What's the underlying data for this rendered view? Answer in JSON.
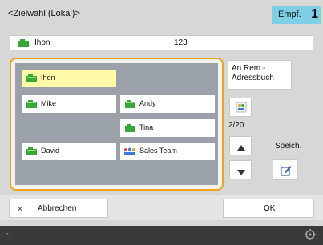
{
  "header": {
    "title": "<Zielwahl (Lokal)>",
    "empf_label": "Empf.",
    "empf_count": "1"
  },
  "selected": {
    "name": "Ihon",
    "number": "123"
  },
  "entries": [
    {
      "label": "Ihon",
      "icon": "address-book-icon"
    },
    {
      "label": "Mike",
      "icon": "address-book-icon"
    },
    {
      "label": "Andy",
      "icon": "address-book-icon"
    },
    {
      "label": "Tina",
      "icon": "address-book-icon"
    },
    {
      "label": "David",
      "icon": "address-book-icon"
    },
    {
      "label": "Sales Team",
      "icon": "group-icon"
    }
  ],
  "side": {
    "remote_book_label": "An Rem.-\nAdressbuch",
    "page_counter": "2/20",
    "save_label": "Speich."
  },
  "footer": {
    "cancel_label": "Abbrechen",
    "ok_label": "OK"
  },
  "colors": {
    "accent_orange": "#f0a31c",
    "header_badge": "#7fd0e7",
    "selected_entry": "#fff9a8",
    "book_green": "#3aa637"
  }
}
